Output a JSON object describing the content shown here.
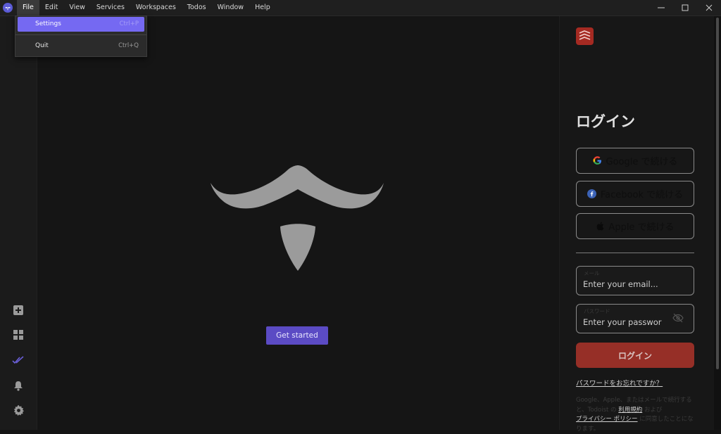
{
  "menubar": {
    "items": [
      "File",
      "Edit",
      "View",
      "Services",
      "Workspaces",
      "Todos",
      "Window",
      "Help"
    ]
  },
  "file_menu": {
    "settings_label": "Settings",
    "settings_shortcut": "Ctrl+P",
    "quit_label": "Quit",
    "quit_shortcut": "Ctrl+Q"
  },
  "main": {
    "get_started_label": "Get started"
  },
  "login": {
    "title": "ログイン",
    "google_label": "Google で続ける",
    "facebook_label": "Facebook で続ける",
    "apple_label": "Apple で続ける",
    "email_label": "メール",
    "email_placeholder": "Enter your email...",
    "password_label": "パスワード",
    "password_placeholder": "Enter your password...",
    "submit_label": "ログイン",
    "forgot_label": "パスワードをお忘れですか？",
    "terms_line1": "Google、Apple、またはメールで続行すると、Todoist の",
    "terms_link1": "利用規約",
    "terms_and": " および",
    "terms_link2": "プライバシー ポリシー",
    "terms_end": " に同意したことになります。"
  },
  "colors": {
    "accent": "#7569f2",
    "get_started": "#5b4bc4",
    "todoist_red": "#a52a22",
    "login_button": "#962f27"
  }
}
